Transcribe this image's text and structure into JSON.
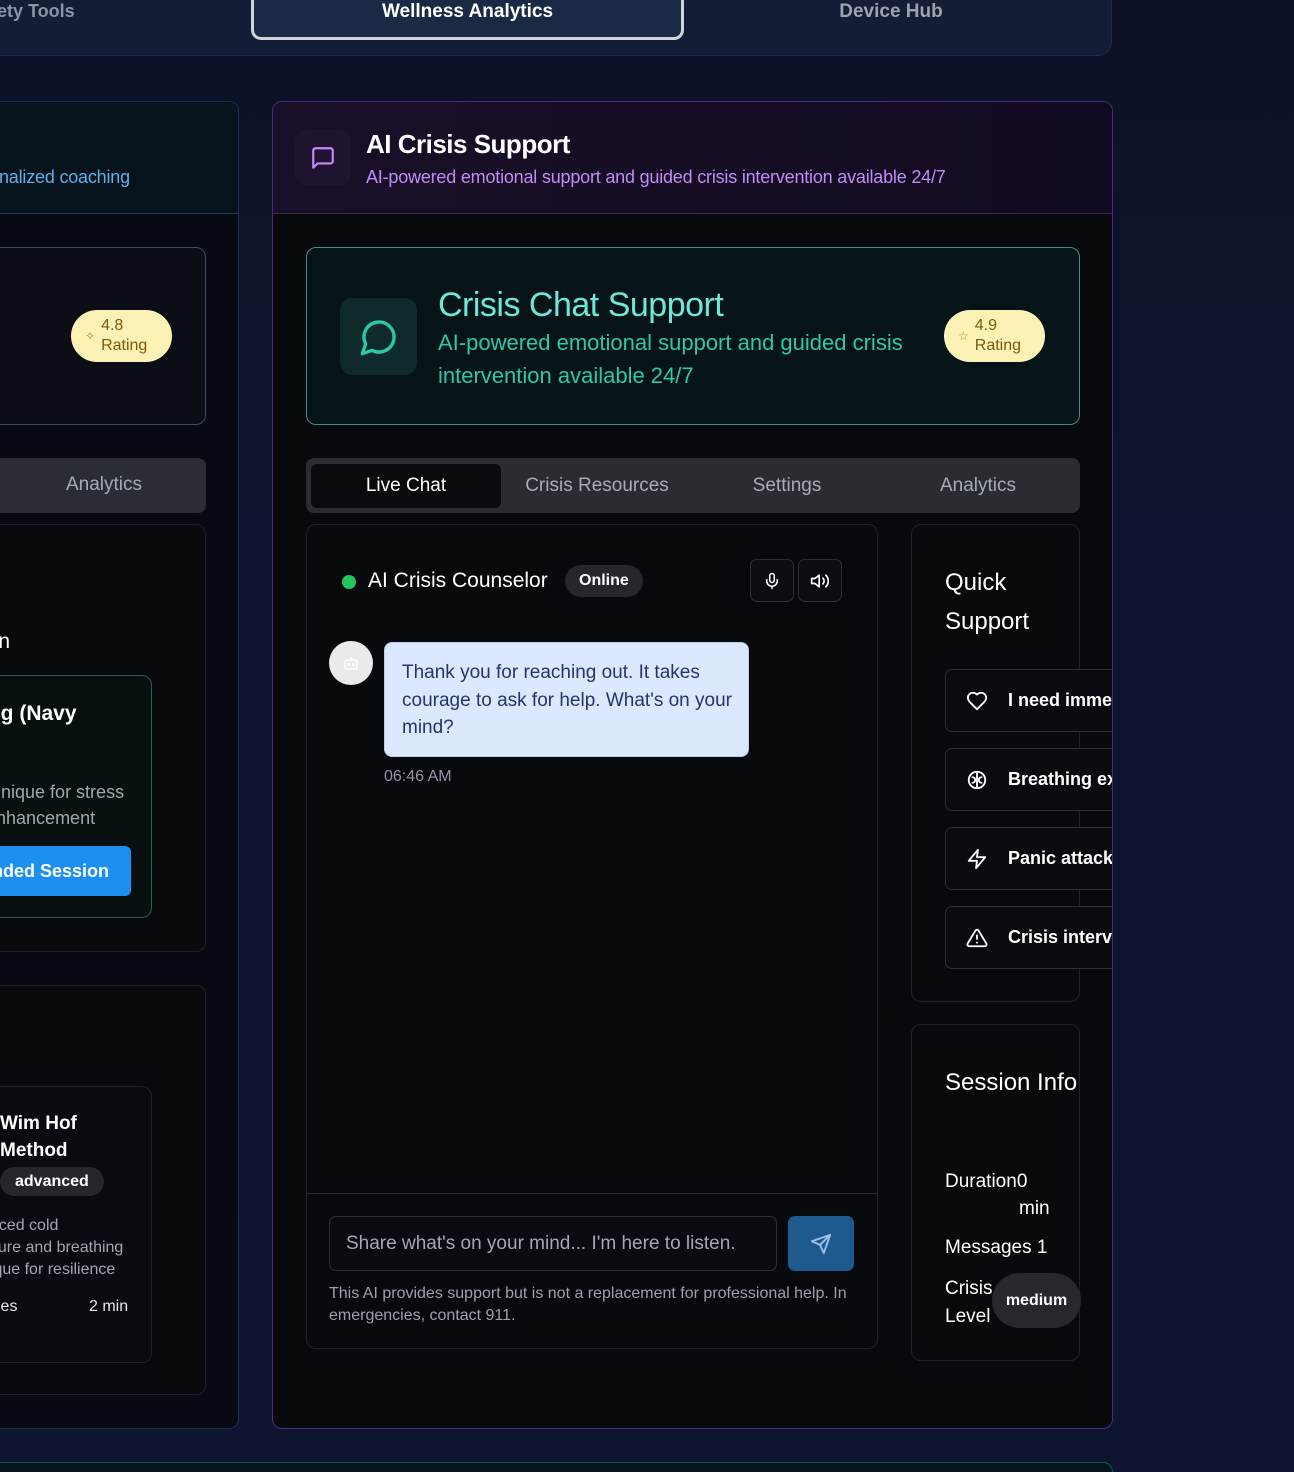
{
  "topnav": {
    "tabs": [
      "afety Tools",
      "Wellness Analytics",
      "Device Hub"
    ],
    "active": "Wellness Analytics"
  },
  "left_card": {
    "header_subtitle": "nalized coaching",
    "rating_value": "4.8",
    "rating_label": "Rating",
    "tab_label": "Analytics",
    "section_title": "ion",
    "technique_title": "ing (Navy",
    "technique_desc_line1": "chnique for stress",
    "technique_desc_line2": "enhancement",
    "technique_button": "ended Session",
    "method_title_line1": "Wim Hof",
    "method_title_line2": "Method",
    "method_level": "advanced",
    "method_desc_line1": "anced cold",
    "method_desc_line2": "osure and breathing",
    "method_desc_line3": "nique for resilience",
    "method_meta_left": "ycles",
    "method_meta_right": "2 min"
  },
  "main": {
    "header_title": "AI Crisis Support",
    "header_subtitle": "AI-powered emotional support and guided crisis intervention available 24/7",
    "feature_title": "Crisis Chat Support",
    "feature_desc": "AI-powered emotional support and guided crisis intervention available 24/7",
    "rating_value": "4.9",
    "rating_label": "Rating",
    "tabs": [
      "Live Chat",
      "Crisis Resources",
      "Settings",
      "Analytics"
    ],
    "active_tab": "Live Chat"
  },
  "chat": {
    "counselor_name": "AI Crisis Counselor",
    "status": "Online",
    "status_color": "#22c55e",
    "message_text": "Thank you for reaching out. It takes courage to ask for help. What's on your mind?",
    "message_time": "06:46 AM",
    "input_placeholder": "Share what's on your mind... I'm here to listen.",
    "disclaimer": "This AI provides support but is not a replacement for professional help. In emergencies, contact 911."
  },
  "quick_support": {
    "title": "Quick Support",
    "items": [
      {
        "icon": "heart-icon",
        "label": "I need imme"
      },
      {
        "icon": "brain-icon",
        "label": "Breathing ex"
      },
      {
        "icon": "zap-icon",
        "label": "Panic attack"
      },
      {
        "icon": "alert-triangle-icon",
        "label": "Crisis interve"
      }
    ]
  },
  "session_info": {
    "title": "Session Info",
    "duration_label": "Duration",
    "duration_value": "0",
    "duration_unit": "min",
    "messages_label": "Messages",
    "messages_value": "1",
    "crisis_label_line1": "Crisis",
    "crisis_label_line2": "Level",
    "crisis_level": "medium"
  },
  "colors": {
    "accent_purple": "#c28af7",
    "accent_teal": "#2bc9a8",
    "send_button": "#1f5a8f",
    "rating_bg": "#fdf2b5"
  }
}
